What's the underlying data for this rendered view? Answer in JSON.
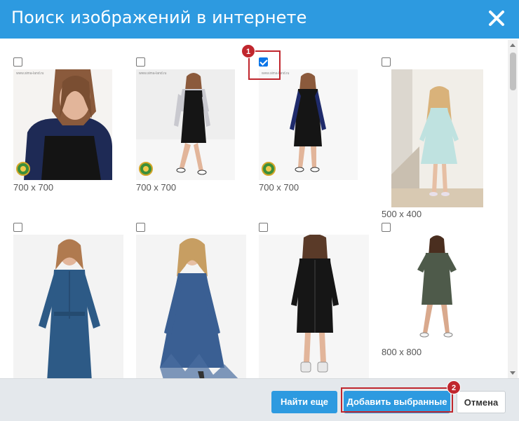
{
  "dialog": {
    "title": "Поиск изображений в интернете",
    "close_icon": "close-icon"
  },
  "images": [
    {
      "size": "700 x 700",
      "checked": false,
      "watermark": "www.sima-land.ru",
      "subject": "woman-dark-dress-closeup"
    },
    {
      "size": "700 x 700",
      "checked": false,
      "watermark": "www.sima-land.ru",
      "subject": "woman-black-pinafore-dress"
    },
    {
      "size": "700 x 700",
      "checked": true,
      "watermark": "www.sima-land.ru",
      "subject": "woman-black-dress-navy-sleeves"
    },
    {
      "size": "500 x 400",
      "checked": false,
      "watermark": "",
      "subject": "girl-mint-dress"
    },
    {
      "size": "",
      "checked": false,
      "watermark": "",
      "subject": "woman-denim-shirt-dress"
    },
    {
      "size": "",
      "checked": false,
      "watermark": "",
      "subject": "woman-blue-lace-hem-dress"
    },
    {
      "size": "",
      "checked": false,
      "watermark": "",
      "subject": "woman-black-dress-back-view"
    },
    {
      "size": "800 x 800",
      "checked": false,
      "watermark": "",
      "subject": "woman-khaki-tshirt-dress"
    }
  ],
  "markers": {
    "one": "1",
    "two": "2"
  },
  "footer": {
    "find_more_label": "Найти еще",
    "add_selected_label": "Добавить выбранные",
    "cancel_label": "Отмена"
  },
  "colors": {
    "header": "#2d9ae0",
    "marker": "#c0262d",
    "footer": "#e4e8ec"
  }
}
